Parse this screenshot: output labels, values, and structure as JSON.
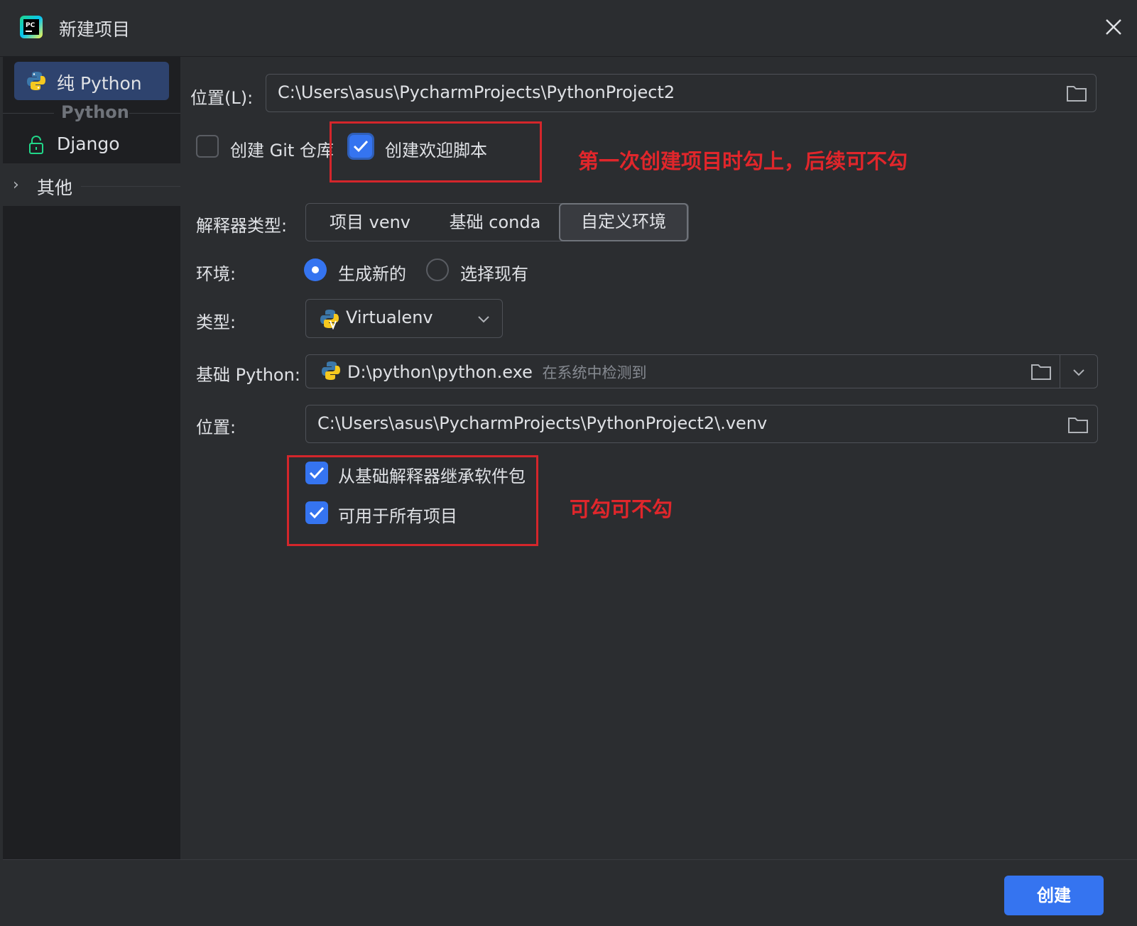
{
  "window": {
    "title": "新建项目",
    "app_icon": "pycharm-icon",
    "close": "close-icon"
  },
  "sidebar": {
    "items": [
      {
        "label": "纯 Python",
        "icon": "python-icon",
        "selected": true
      },
      {
        "label": "Django",
        "icon": "lock-icon",
        "selected": false
      }
    ],
    "group_label": "Python",
    "others_label": "其他"
  },
  "form": {
    "location_label": "位置(L):",
    "location_value": "C:\\Users\\asus\\PycharmProjects\\PythonProject2",
    "git_checkbox_label": "创建 Git 仓库",
    "git_checked": false,
    "welcome_checkbox_label": "创建欢迎脚本",
    "welcome_checked": true,
    "interpreter_type_label": "解释器类型:",
    "interpreter_tabs": [
      "项目 venv",
      "基础 conda",
      "自定义环境"
    ],
    "interpreter_selected": "自定义环境",
    "env_label": "环境:",
    "env_options": [
      "生成新的",
      "选择现有"
    ],
    "env_selected": "生成新的",
    "type_label": "类型:",
    "type_value": "Virtualenv",
    "base_python_label": "基础 Python:",
    "base_python_value": "D:\\python\\python.exe",
    "base_python_hint": "在系统中检测到",
    "venv_location_label": "位置:",
    "venv_location_value": "C:\\Users\\asus\\PycharmProjects\\PythonProject2\\.venv",
    "inherit_label": "从基础解释器继承软件包",
    "inherit_checked": true,
    "all_projects_label": "可用于所有项目",
    "all_projects_checked": true
  },
  "annotations": {
    "note1": "第一次创建项目时勾上，后续可不勾",
    "note2": "可勾可不勾",
    "color": "#e0262b"
  },
  "footer": {
    "create_label": "创建",
    "accent": "#3574f0"
  }
}
